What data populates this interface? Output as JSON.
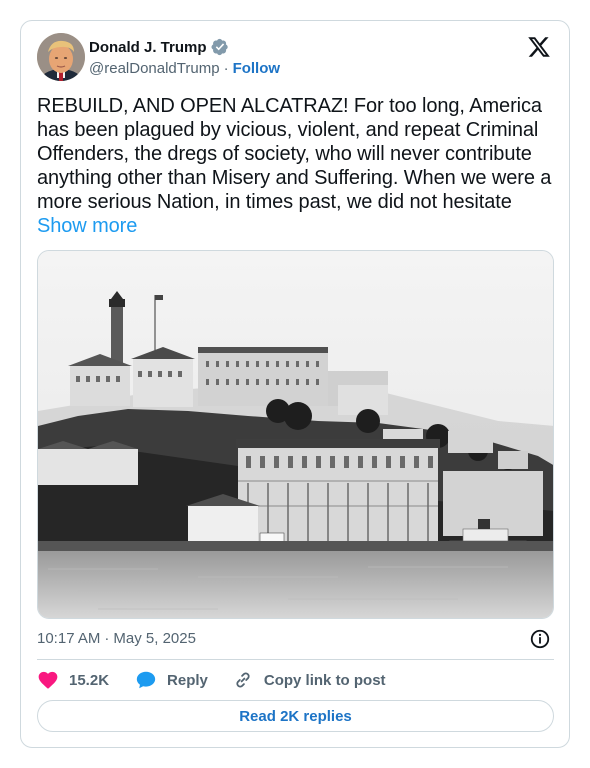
{
  "author": {
    "name": "Donald J. Trump",
    "handle": "@realDonaldTrump",
    "separator": "·",
    "follow_label": "Follow"
  },
  "tweet": {
    "text": "REBUILD, AND OPEN ALCATRAZ! For too long, America has been plagued by vicious, violent, and repeat Criminal Offenders, the dregs of society, who will never contribute anything other than Misery and Suffering. When we were a more serious Nation, in times past, we did not hesitate ",
    "show_more_label": "Show more"
  },
  "meta": {
    "time": "10:17 AM",
    "separator": "·",
    "date": "May 5, 2025"
  },
  "actions": {
    "likes": "15.2K",
    "reply_label": "Reply",
    "copy_label": "Copy link to post"
  },
  "footer": {
    "read_replies_label": "Read 2K replies"
  },
  "icons": {
    "verified": "verified-badge-icon",
    "logo": "x-logo-icon",
    "info": "info-icon",
    "like": "heart-icon",
    "reply": "reply-bubble-icon",
    "copy": "link-icon"
  },
  "colors": {
    "link": "#1d9bf0",
    "follow": "#1d74c6",
    "heart": "#f91880",
    "reply_bubble": "#1d9bf0",
    "muted": "#536471",
    "border": "#cfd9de"
  }
}
